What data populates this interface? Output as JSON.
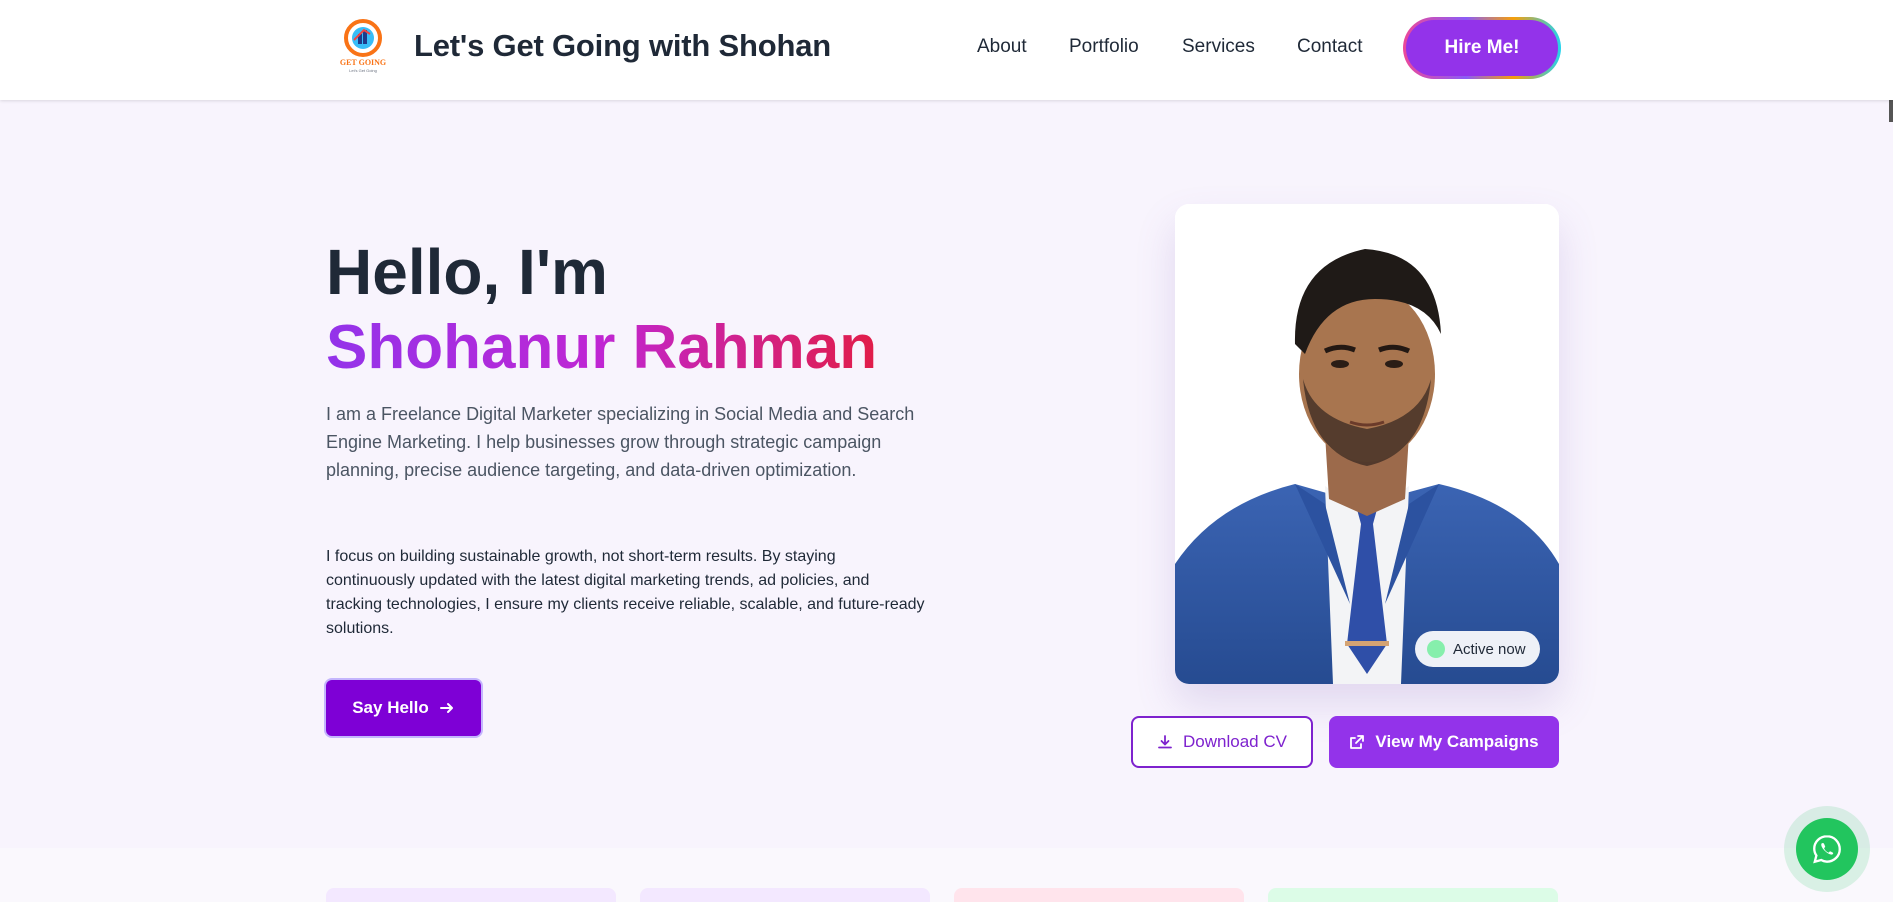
{
  "header": {
    "brand_title": "Let's Get Going with Shohan",
    "logo": {
      "text": "GET GOING",
      "tagline": "Let's Get Going"
    },
    "nav": [
      {
        "label": "About"
      },
      {
        "label": "Portfolio"
      },
      {
        "label": "Services"
      },
      {
        "label": "Contact"
      }
    ],
    "hire_button": "Hire Me!"
  },
  "hero": {
    "greeting": "Hello, I'm",
    "name": "Shohanur Rahman",
    "intro": "I am a Freelance Digital Marketer specializing in Social Media and Search Engine Marketing. I help businesses grow through strategic campaign planning, precise audience targeting, and data-driven optimization.",
    "focus": "I focus on building sustainable growth, not short-term results. By staying continuously updated with the latest digital marketing trends, ad policies, and tracking technologies, I ensure my clients receive reliable, scalable, and future-ready solutions.",
    "say_hello_button": "Say Hello",
    "active_badge": "Active now",
    "download_button": "Download CV",
    "campaigns_button": "View My Campaigns"
  },
  "colors": {
    "accent": "#9333ea",
    "accent_dark": "#7e00d6",
    "gradient_end": "#e11d48",
    "whatsapp": "#22c55e",
    "active_dot": "#86efac"
  },
  "icons": {
    "download": "download-icon",
    "external": "external-link-icon",
    "arrow": "arrow-right-icon",
    "whatsapp": "whatsapp-icon"
  }
}
